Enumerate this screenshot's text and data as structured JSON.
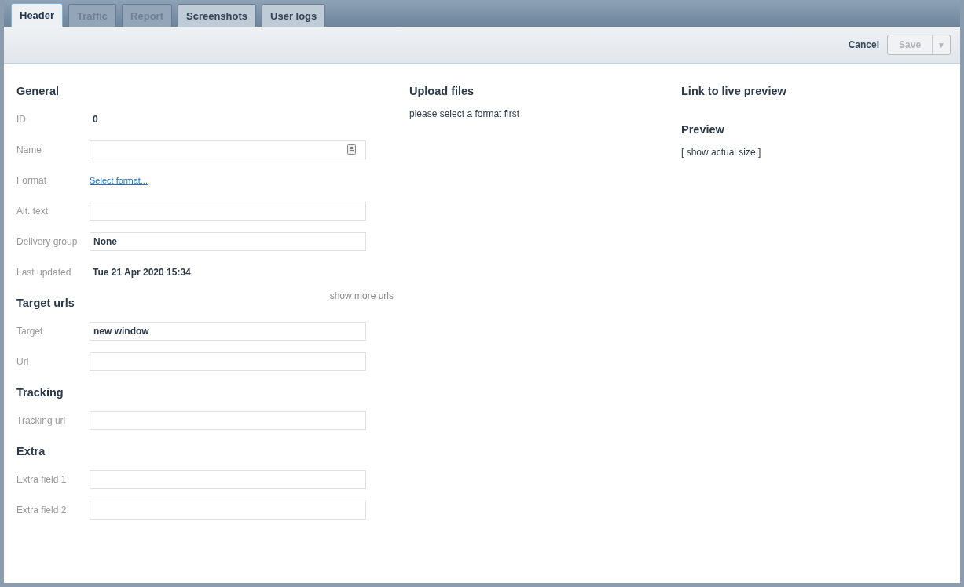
{
  "tabs": [
    {
      "label": "Header",
      "selected": true,
      "disabled": false
    },
    {
      "label": "Traffic",
      "selected": false,
      "disabled": true
    },
    {
      "label": "Report",
      "selected": false,
      "disabled": true
    },
    {
      "label": "Screenshots",
      "selected": false,
      "disabled": false
    },
    {
      "label": "User logs",
      "selected": false,
      "disabled": false
    }
  ],
  "toolbar": {
    "cancel": "Cancel",
    "save": {
      "label": "Save",
      "disabled": true
    },
    "save_menu": "▼"
  },
  "sections": [
    {
      "title": "General",
      "rows": [
        {
          "label": "ID",
          "kind": "value",
          "value": "0"
        },
        {
          "label": "Name",
          "kind": "input-icon"
        },
        {
          "label": "Format",
          "kind": "link",
          "value": "Select format..."
        },
        {
          "label": "Alt. text",
          "kind": "input"
        },
        {
          "label": "Delivery group",
          "kind": "input",
          "value": "None"
        },
        {
          "label": "Last updated",
          "kind": "value",
          "value": "Tue 21 Apr 2020 15:34"
        }
      ]
    },
    {
      "title": "Target urls",
      "aside": "show more urls",
      "rows": [
        {
          "label": "Target",
          "kind": "input",
          "value": "new window"
        },
        {
          "label": "Url",
          "kind": "input"
        }
      ]
    },
    {
      "title": "Tracking",
      "rows": [
        {
          "label": "Tracking url",
          "kind": "input"
        }
      ]
    },
    {
      "title": "Extra",
      "rows": [
        {
          "label": "Extra field 1",
          "kind": "input"
        },
        {
          "label": "Extra field 2",
          "kind": "input"
        }
      ]
    }
  ],
  "upload": {
    "title": "Upload files",
    "note": "please select a format first"
  },
  "preview": {
    "link_title": "Link to live preview",
    "title": "Preview",
    "size_link": "[ show actual size ]"
  }
}
